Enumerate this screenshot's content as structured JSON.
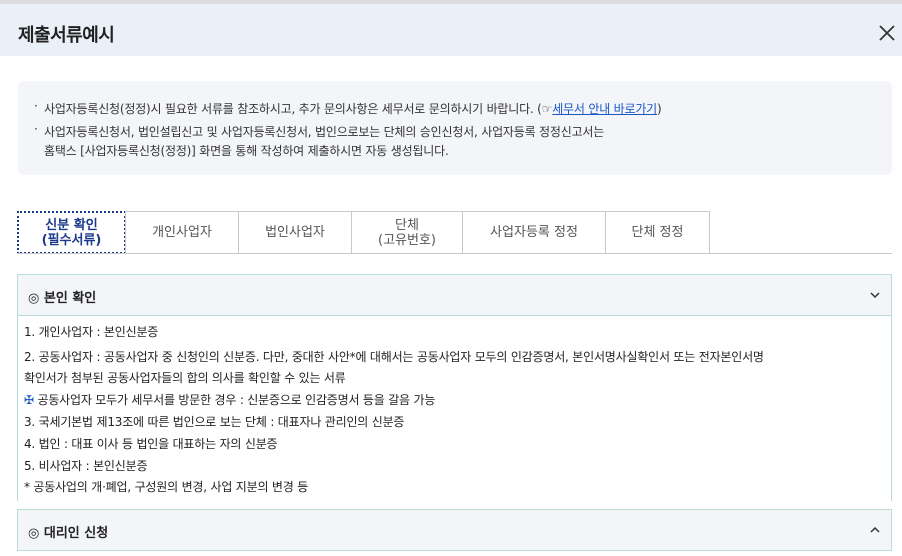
{
  "header": {
    "title": "제출서류예시",
    "close_icon": "close-icon"
  },
  "notice": {
    "line1_text": "사업자등록신청(정정)시 필요한 서류를 참조하시고, 추가 문의사항은 세무서로 문의하시기 바랍니다. (",
    "line1_hand": "☞",
    "line1_link": "세무서 안내 바로가기",
    "line1_end": ")",
    "line2": "사업자등록신청서, 법인설립신고 및 사업자등록신청서, 법인으로보는 단체의 승인신청서, 사업자등록 정정신고서는",
    "line3": "홈택스 [사업자등록신청(정정)] 화면을 통해 작성하여 제출하시면 자동 생성됩니다."
  },
  "tabs": [
    {
      "line1": "신분 확인",
      "line2": "(필수서류)",
      "active": true
    },
    {
      "line1": "개인사업자",
      "line2": ""
    },
    {
      "line1": "법인사업자",
      "line2": ""
    },
    {
      "line1": "단체",
      "line2": "(고유번호)"
    },
    {
      "line1": "사업자등록 정정",
      "line2": ""
    },
    {
      "line1": "단체 정정",
      "line2": ""
    }
  ],
  "section1": {
    "title": "◎ 본인 확인",
    "chevron": "chevron-down-icon",
    "lines": [
      "1. 개인사업자 : 본인신분증",
      "2. 공동사업자 : 공동사업자 중 신청인의 신분증. 다만, 중대한 사안*에 대해서는 공동사업자 모두의 인감증명서, 본인서명사실확인서 또는 전자본인서명",
      "확인서가 첨부된 공동사업자들의 합의 의사를 확인할 수 있는 서류",
      "공동사업자 모두가 세무서를 방문한 경우 : 신분증으로 인감증명서 등을 갈음 가능",
      "3. 국세기본법 제13조에 따른 법인으로 보는 단체 : 대표자나 관리인의 신분증",
      "4. 법인 : 대표 이사 등 법인을 대표하는 자의 신분증",
      "5. 비사업자 : 본인신분증",
      "* 공동사업의 개·폐업, 구성원의 변경, 사업 지분의 변경 등"
    ],
    "cross_symbol": "✠"
  },
  "section2": {
    "title": "◎ 대리인 신청",
    "chevron": "chevron-up-icon"
  }
}
